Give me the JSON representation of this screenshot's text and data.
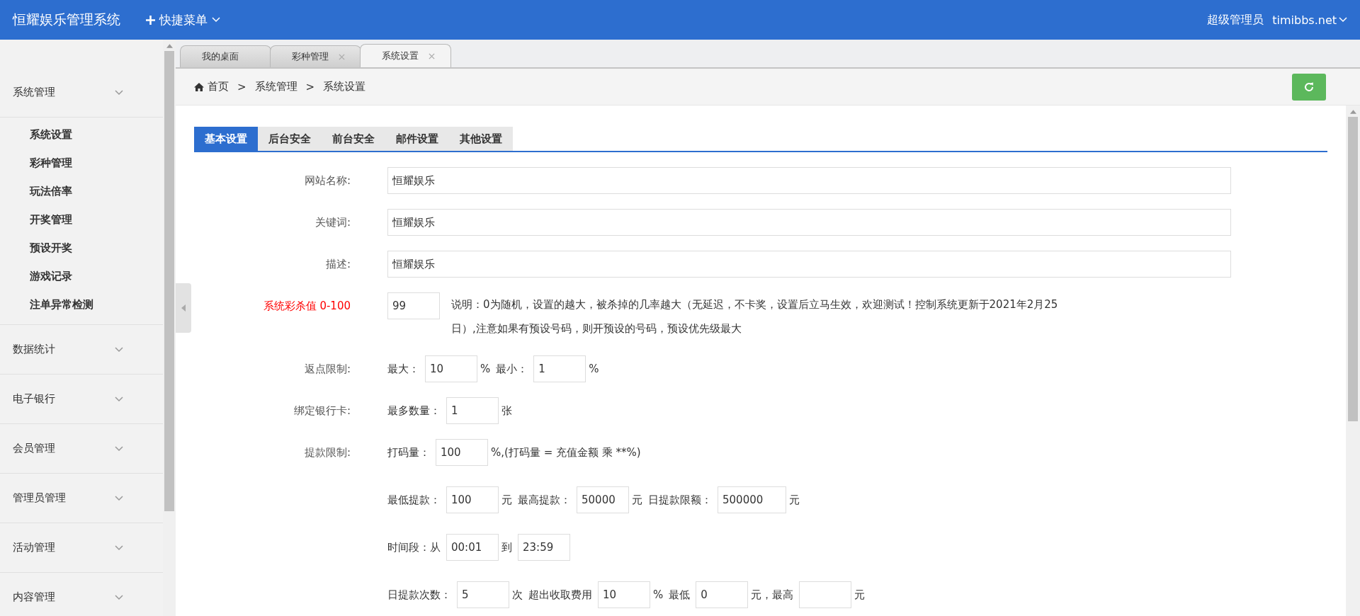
{
  "header": {
    "title": "恒耀娱乐管理系统",
    "quick_menu": "快捷菜单",
    "user_role": "超级管理员",
    "user_name": "timibbs.net"
  },
  "sidebar": {
    "items": [
      {
        "label": "系统管理",
        "children": [
          {
            "label": "系统设置"
          },
          {
            "label": "彩种管理"
          },
          {
            "label": "玩法倍率"
          },
          {
            "label": "开奖管理"
          },
          {
            "label": "预设开奖"
          },
          {
            "label": "游戏记录"
          },
          {
            "label": "注单异常检测"
          }
        ]
      },
      {
        "label": "数据统计"
      },
      {
        "label": "电子银行"
      },
      {
        "label": "会员管理"
      },
      {
        "label": "管理员管理"
      },
      {
        "label": "活动管理"
      },
      {
        "label": "内容管理"
      }
    ]
  },
  "page_tabs": [
    {
      "label": "我的桌面",
      "selected": false,
      "closable": false
    },
    {
      "label": "彩种管理",
      "selected": false,
      "closable": true
    },
    {
      "label": "系统设置",
      "selected": true,
      "closable": true
    }
  ],
  "breadcrumb": [
    "首页",
    ">",
    "系统管理",
    ">",
    "系统设置"
  ],
  "settings_tabs": [
    {
      "label": "基本设置",
      "selected": true
    },
    {
      "label": "后台安全",
      "selected": false
    },
    {
      "label": "前台安全",
      "selected": false
    },
    {
      "label": "邮件设置",
      "selected": false
    },
    {
      "label": "其他设置",
      "selected": false
    }
  ],
  "form": [
    {
      "label": "网站名称:",
      "alert": false,
      "parts": [
        {
          "kind": "wide_input",
          "value": "恒耀娱乐"
        }
      ]
    },
    {
      "label": "关键词:",
      "alert": false,
      "parts": [
        {
          "kind": "wide_input",
          "value": "恒耀娱乐"
        }
      ]
    },
    {
      "label": "描述:",
      "alert": false,
      "parts": [
        {
          "kind": "wide_input",
          "value": "恒耀娱乐"
        }
      ]
    },
    {
      "label": "系统彩杀值 0-100",
      "alert": true,
      "parts": [
        {
          "kind": "input",
          "value": "99"
        },
        {
          "kind": "text",
          "text": "说明：0为随机，设置的越大，被杀掉的几率越大（无延迟，不卡奖，设置后立马生效，欢迎测试！控制系统更新于2021年2月25日）,注意如果有预设号码，则开预设的号码，预设优先级最大"
        }
      ]
    },
    {
      "label": "返点限制:",
      "alert": false,
      "parts": [
        {
          "kind": "text",
          "text": "最大："
        },
        {
          "kind": "input",
          "value": "10"
        },
        {
          "kind": "text",
          "text": "%"
        },
        {
          "kind": "text",
          "text": "最小："
        },
        {
          "kind": "input",
          "value": "1"
        },
        {
          "kind": "text",
          "text": "%"
        }
      ]
    },
    {
      "label": "绑定银行卡:",
      "alert": false,
      "parts": [
        {
          "kind": "text",
          "text": "最多数量："
        },
        {
          "kind": "input",
          "value": "1"
        },
        {
          "kind": "text",
          "text": "张"
        }
      ]
    },
    {
      "label": "提款限制:",
      "alert": false,
      "parts": [
        {
          "kind": "text",
          "text": "打码量："
        },
        {
          "kind": "input",
          "value": "100"
        },
        {
          "kind": "text",
          "text": "%,(打码量 = 充值金额 乘 **%)"
        }
      ]
    },
    {
      "parts": [
        {
          "kind": "text",
          "text": "最低提款："
        },
        {
          "kind": "input",
          "value": "100"
        },
        {
          "kind": "text",
          "text": "元"
        },
        {
          "kind": "text",
          "text": "最高提款："
        },
        {
          "kind": "input",
          "value": "50000"
        },
        {
          "kind": "text",
          "text": "元"
        },
        {
          "kind": "text",
          "text": "日提款限额："
        },
        {
          "kind": "long_input",
          "value": "500000"
        },
        {
          "kind": "text",
          "text": "元"
        }
      ]
    },
    {
      "parts": [
        {
          "kind": "text",
          "text": "时间段：从"
        },
        {
          "kind": "input",
          "value": "00:01"
        },
        {
          "kind": "text",
          "text": "到"
        },
        {
          "kind": "input",
          "value": "23:59"
        }
      ]
    },
    {
      "parts": [
        {
          "kind": "text",
          "text": "日提款次数："
        },
        {
          "kind": "input",
          "value": "5"
        },
        {
          "kind": "text",
          "text": "次"
        },
        {
          "kind": "text",
          "text": "超出收取费用"
        },
        {
          "kind": "input",
          "value": "10"
        },
        {
          "kind": "text",
          "text": "%"
        },
        {
          "kind": "text",
          "text": "最低"
        },
        {
          "kind": "input",
          "value": "0"
        },
        {
          "kind": "text",
          "text": "元，最高"
        },
        {
          "kind": "input"
        },
        {
          "kind": "text",
          "text": "元"
        }
      ]
    }
  ]
}
